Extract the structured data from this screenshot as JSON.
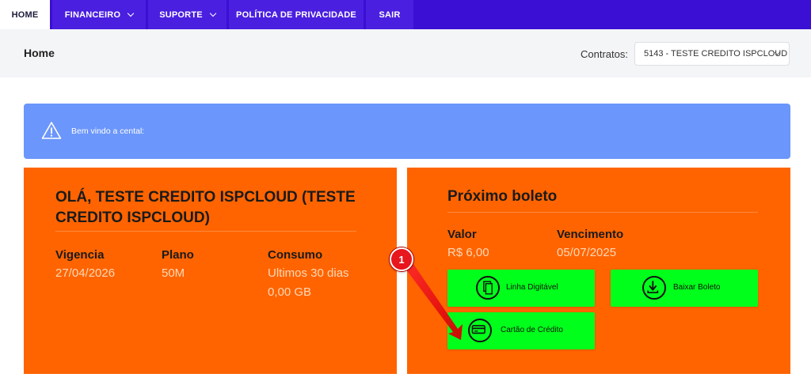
{
  "nav": {
    "items": [
      {
        "label": "HOME"
      },
      {
        "label": "FINANCEIRO"
      },
      {
        "label": "SUPORTE"
      },
      {
        "label": "POLÍTICA DE PRIVACIDADE"
      },
      {
        "label": "SAIR"
      }
    ]
  },
  "header": {
    "title": "Home",
    "contracts_label": "Contratos:",
    "contracts_selected": "5143 - TESTE CREDITO ISPCLOUD"
  },
  "alert": {
    "icon": "warning-triangle-icon",
    "text": "Bem vindo a cental:"
  },
  "customer": {
    "greeting": "OLÁ, TESTE CREDITO ISPCLOUD (TESTE CREDITO ISPCLOUD)",
    "vigencia_label": "Vigencia",
    "vigencia_value": "27/04/2026",
    "plano_label": "Plano",
    "plano_value": "50M",
    "consumo_label": "Consumo",
    "consumo_value": "Ultimos 30 dias 0,00 GB"
  },
  "boleto": {
    "title": "Próximo boleto",
    "valor_label": "Valor",
    "valor_value": "R$ 6,00",
    "vencimento_label": "Vencimento",
    "vencimento_value": "05/07/2025",
    "btn_linha": "Linha Digitável",
    "btn_baixar": "Baixar Boleto",
    "btn_cartao": "Cartão de Crédito"
  },
  "annotation": {
    "number": "1"
  },
  "colors": {
    "nav_bg": "#3b0fd4",
    "card_bg": "#ff6400",
    "alert_bg": "#6b96fb",
    "button_bg": "#00ff1a",
    "annotation": "#e8161d"
  }
}
